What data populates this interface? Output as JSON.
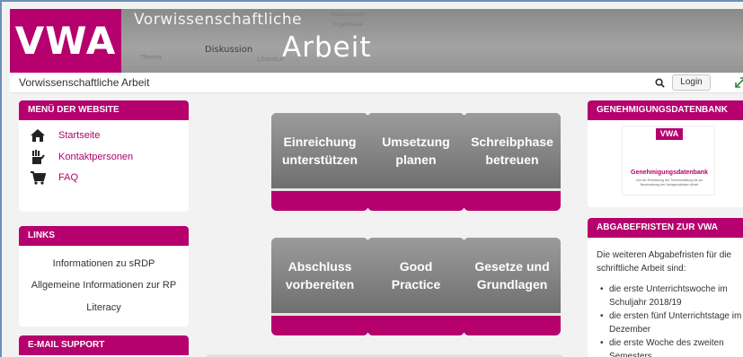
{
  "banner": {
    "logo": "VWA",
    "top_text": "Vorwissenschaftliche",
    "main_text": "Arbeit",
    "word_cloud": [
      "Diskussion",
      "Präsentation",
      "Thema",
      "Literatur",
      "Ergebnisse"
    ]
  },
  "topbar": {
    "site_name": "Vorwissenschaftliche Arbeit",
    "login_label": "Login",
    "search_icon": "search-icon",
    "expand_icon": "expand-icon"
  },
  "sidebar_left": {
    "menu": {
      "title": "MENÜ DER WEBSITE",
      "items": [
        {
          "label": "Startseite",
          "icon": "home-icon"
        },
        {
          "label": "Kontaktpersonen",
          "icon": "contacts-icon"
        },
        {
          "label": "FAQ",
          "icon": "cart-icon"
        }
      ]
    },
    "links": {
      "title": "LINKS",
      "items": [
        "Informationen zu sRDP",
        "Allgemeine Informationen zur RP",
        "Literacy"
      ]
    },
    "email": {
      "title": "E-MAIL SUPPORT"
    }
  },
  "tiles": [
    {
      "label": "Einreichung\nunterstützen"
    },
    {
      "label": "Umsetzung\nplanen"
    },
    {
      "label": "Schreibphase\nbetreuen"
    },
    {
      "label": "Abschluss\nvorbereiten"
    },
    {
      "label": "Good\nPractice"
    },
    {
      "label": "Gesetze und\nGrundlagen"
    }
  ],
  "sidebar_right": {
    "genehmigung": {
      "title": "GENEHMIGUNGSDATENBANK",
      "image_logo": "VWA",
      "image_title": "Genehmigungsdatenbank",
      "image_subtitle": "Von der Einreichung der Themenstellung bis zur Beschreibung der Vorlageindenken Arbeit"
    },
    "abgabefristen": {
      "title": "ABGABEFRISTEN ZUR VWA",
      "intro": "Die weiteren Abgabefristen für die schriftliche Arbeit sind:",
      "items": [
        "die erste Unterrichtswoche im Schuljahr 2018/19",
        "die ersten fünf Unterrichtstage im Dezember",
        "die erste Woche des zweiten Semesters"
      ]
    }
  },
  "colors": {
    "brand": "#b5006d",
    "tile_gray": "#7f7f7f",
    "background": "#f2f2f2"
  }
}
